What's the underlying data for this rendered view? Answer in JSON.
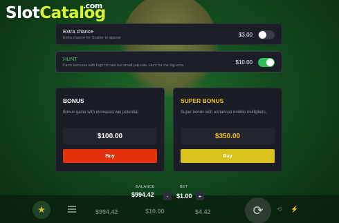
{
  "logo": {
    "part1": "Slot",
    "part2": "Catalog",
    "suffix": ".com"
  },
  "options": [
    {
      "title": "Extra chance",
      "description": "Extra chance for Scatter to appear",
      "price": "$3.00",
      "enabled": false
    },
    {
      "title": "HUNT",
      "description": "Farm bonuses with high hit rate but small payouts. Hunt for the big wins",
      "price": "$10.00",
      "enabled": true
    }
  ],
  "bonuses": [
    {
      "title": "BONUS",
      "description": "Bonus game with increased win potential",
      "price": "$100.00",
      "buy_label": "Buy"
    },
    {
      "title": "SUPER BONUS",
      "description": "Super bonus with enhanced double multipliers.",
      "price": "$350.00",
      "buy_label": "Buy"
    }
  ],
  "footer": {
    "balance_label": "BALANCE",
    "balance_value": "$994.42",
    "bet_label": "BET",
    "bet_value": "$1.00",
    "minus": "-",
    "plus": "+",
    "dim_balance": "$994.42",
    "dim_bet": "$10.00",
    "dim_win": "$4.42"
  },
  "icons": {
    "star": "★",
    "spin": "⟳",
    "autoplay": "⟲",
    "turbo": "⚡"
  },
  "colors": {
    "background": "#124a1d",
    "panel": "#1b1d27",
    "toggle_on": "#2fbf5a",
    "buy_red": "#e3320b",
    "buy_yellow": "#d9c21b",
    "gold_text": "#f2c31a",
    "logo_accent": "#d9f237"
  }
}
